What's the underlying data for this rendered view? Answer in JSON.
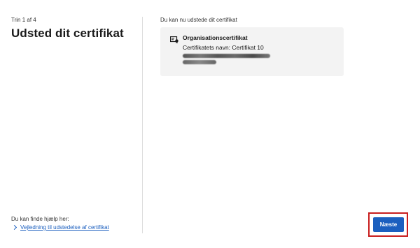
{
  "left": {
    "step": "Trin 1 af 4",
    "title": "Udsted dit certifikat"
  },
  "help": {
    "text": "Du kan finde hjælp her:",
    "link": "Vejledning til udstedelse af certifikat"
  },
  "main": {
    "intro": "Du kan nu udstede dit certifikat",
    "card": {
      "type": "Organisationscertifikat",
      "name": "Certifikatets navn: Certifikat 10",
      "icon": "certificate-icon"
    }
  },
  "actions": {
    "next_label": "Næste"
  },
  "colors": {
    "accent": "#1b5fbf",
    "highlight": "#c81e1e",
    "card_bg": "#f3f3f3"
  }
}
